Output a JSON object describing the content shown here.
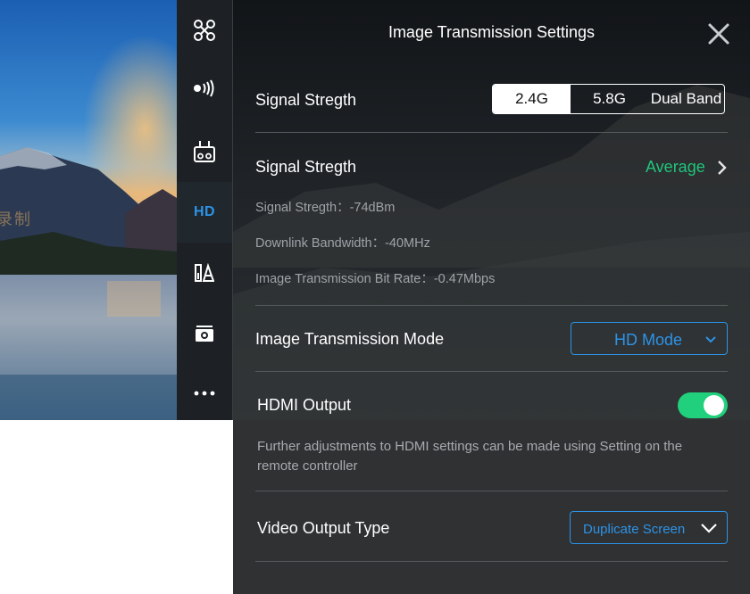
{
  "preview": {
    "overlay_text": "录制"
  },
  "sidebar": {
    "items": [
      {
        "icon": "aircraft-icon"
      },
      {
        "icon": "signal-icon"
      },
      {
        "icon": "remote-controller-icon"
      },
      {
        "icon": "hd-icon",
        "label": "HD",
        "active": true
      },
      {
        "icon": "battery-icon"
      },
      {
        "icon": "camera-icon"
      },
      {
        "icon": "more-icon"
      }
    ]
  },
  "panel": {
    "title": "Image Transmission Settings",
    "close_icon": "close-icon"
  },
  "frequency": {
    "label": "Signal Stregth",
    "options": [
      "2.4G",
      "5.8G",
      "Dual Band"
    ],
    "selected": "2.4G"
  },
  "signal": {
    "label": "Signal Stregth",
    "quality": "Average",
    "quality_color": "#21c47a",
    "strength": "Signal Stregth：-74dBm",
    "bandwidth": "Downlink Bandwidth：-40MHz",
    "bitrate": "Image Transmission Bit Rate：-0.47Mbps"
  },
  "transmission_mode": {
    "label": "Image Transmission Mode",
    "value": "HD Mode"
  },
  "hdmi": {
    "label": "HDMI Output",
    "enabled": true,
    "note": "Further adjustments to HDMI settings can be made using Setting on the remote controller"
  },
  "video_output": {
    "label": "Video Output Type",
    "value": "Duplicate Screen"
  },
  "colors": {
    "accent": "#2d93e6",
    "toggle_on": "#21d07c",
    "panel_bg": "#2f3133"
  }
}
